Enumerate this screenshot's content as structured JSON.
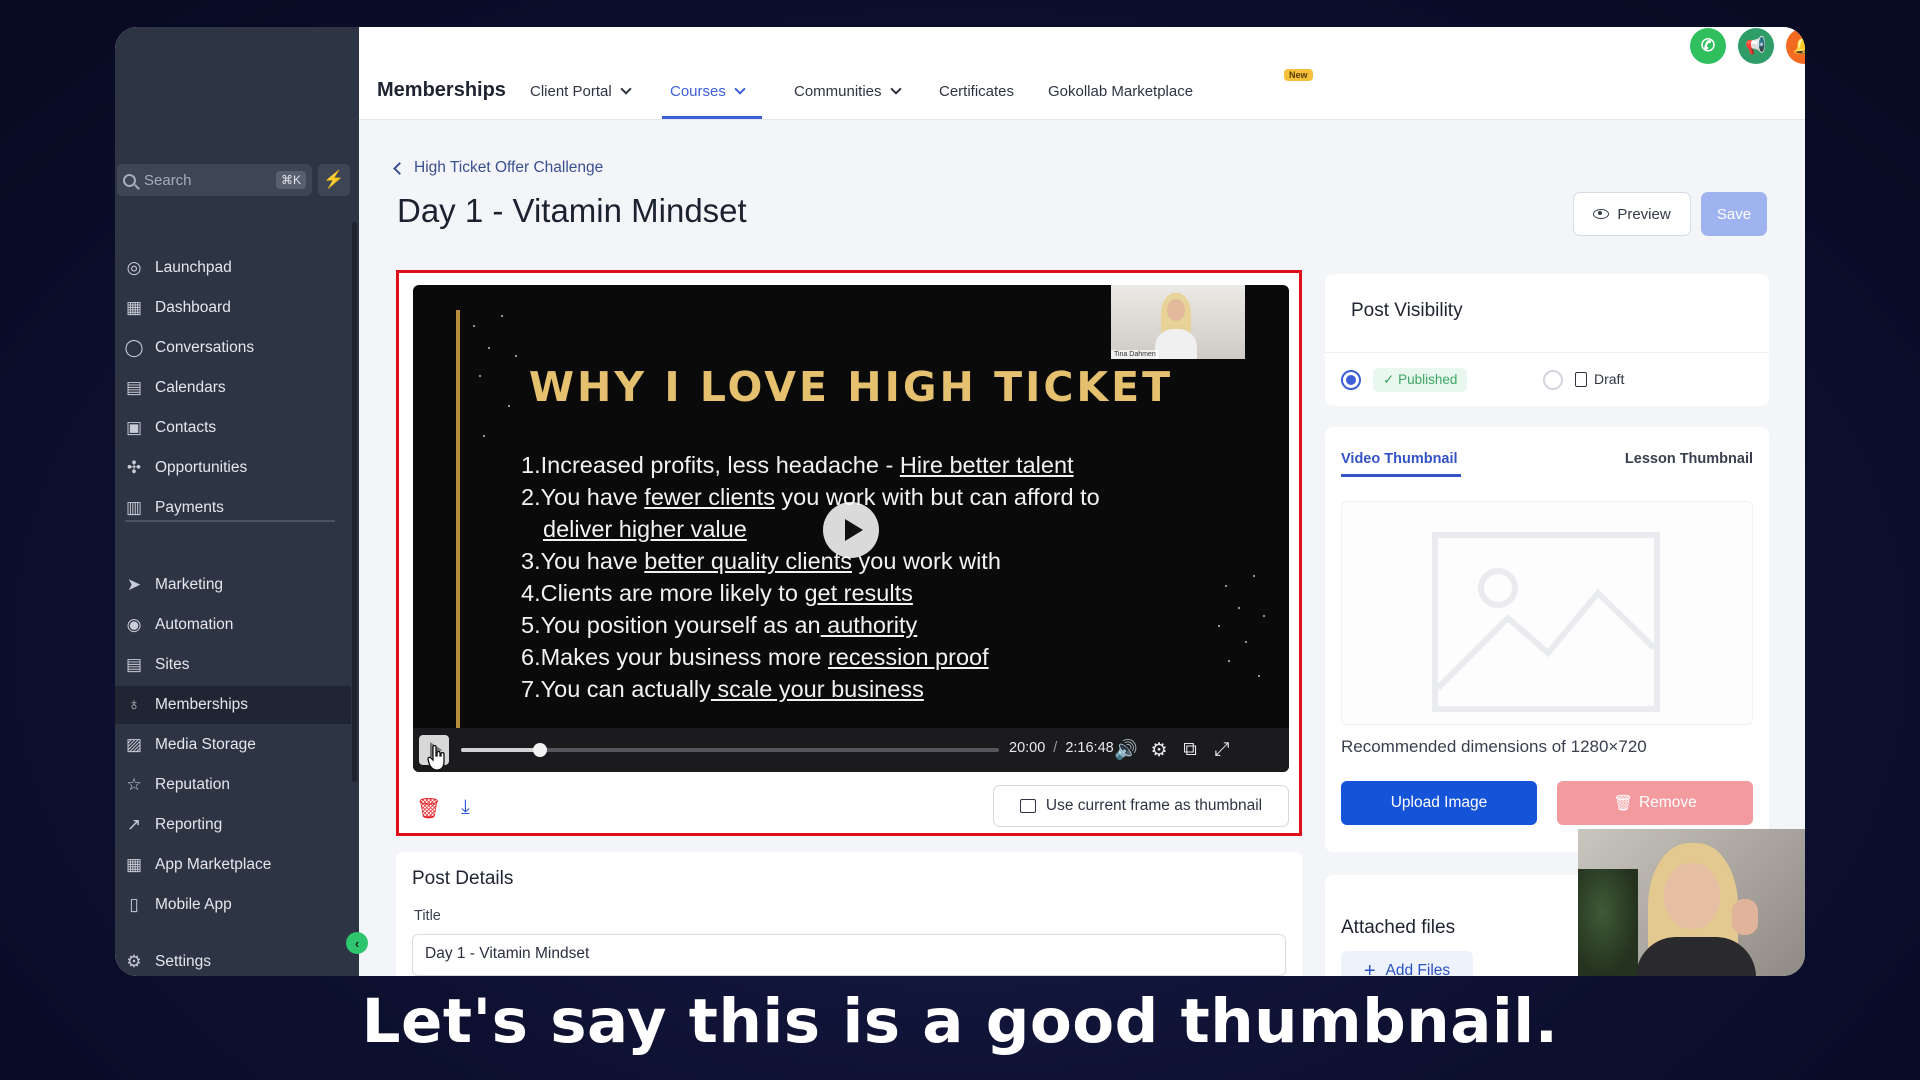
{
  "app": {
    "name": "Memberships"
  },
  "sidebar": {
    "search_placeholder": "Search",
    "search_shortcut": "⌘K",
    "items": [
      {
        "label": "Launchpad",
        "icon": "launchpad-icon"
      },
      {
        "label": "Dashboard",
        "icon": "grid-icon"
      },
      {
        "label": "Conversations",
        "icon": "chat-icon"
      },
      {
        "label": "Calendars",
        "icon": "calendar-icon"
      },
      {
        "label": "Contacts",
        "icon": "contacts-icon"
      },
      {
        "label": "Opportunities",
        "icon": "opportunities-icon"
      },
      {
        "label": "Payments",
        "icon": "payments-icon"
      },
      {
        "label": "Marketing",
        "icon": "send-icon"
      },
      {
        "label": "Automation",
        "icon": "automation-icon"
      },
      {
        "label": "Sites",
        "icon": "sites-icon"
      },
      {
        "label": "Memberships",
        "icon": "memberships-icon",
        "active": true
      },
      {
        "label": "Media Storage",
        "icon": "image-icon"
      },
      {
        "label": "Reputation",
        "icon": "star-icon"
      },
      {
        "label": "Reporting",
        "icon": "trend-icon"
      },
      {
        "label": "App Marketplace",
        "icon": "apps-icon"
      },
      {
        "label": "Mobile App",
        "icon": "phone-icon"
      }
    ],
    "settings_label": "Settings"
  },
  "topnav": {
    "title": "Memberships",
    "tabs": [
      {
        "label": "Client Portal",
        "dropdown": true
      },
      {
        "label": "Courses",
        "dropdown": true,
        "active": true
      },
      {
        "label": "Communities",
        "dropdown": true
      },
      {
        "label": "Certificates"
      },
      {
        "label": "Gokollab Marketplace",
        "badge": "New"
      }
    ],
    "icons": [
      {
        "name": "phone-call-icon",
        "color": "#2fbf5d",
        "glyph": "✆"
      },
      {
        "name": "megaphone-icon",
        "color": "#2f9d68",
        "glyph": "📢"
      },
      {
        "name": "bell-icon",
        "color": "#f26b21",
        "glyph": "🔔"
      },
      {
        "name": "help-icon",
        "color": "#2b8de8",
        "glyph": "?"
      },
      {
        "name": "user-avatar-icon",
        "color": "#c8b5a0",
        "glyph": ""
      }
    ]
  },
  "page": {
    "breadcrumb": "High Ticket Offer Challenge",
    "title": "Day 1 - Vitamin Mindset",
    "preview_label": "Preview",
    "save_label": "Save"
  },
  "video": {
    "cam_label": "Tina Dahmen",
    "slide_title": "WHY I LOVE HIGH TICKET",
    "slide_items": [
      {
        "num": "1.",
        "parts": [
          [
            "Increased profits, less headache - ",
            false
          ],
          [
            " Hire better talent",
            true
          ]
        ]
      },
      {
        "num": "2.",
        "parts": [
          [
            "You have ",
            false
          ],
          [
            "fewer clients",
            true
          ],
          [
            " you work with but can afford to",
            false
          ]
        ]
      },
      {
        "num": "",
        "parts": [
          [
            "deliver higher value",
            true
          ]
        ]
      },
      {
        "num": "3.",
        "parts": [
          [
            "You have ",
            false
          ],
          [
            "better quality clients",
            true
          ],
          [
            " you work with",
            false
          ]
        ]
      },
      {
        "num": "4.",
        "parts": [
          [
            "Clients are more likely to ",
            false
          ],
          [
            "get results",
            true
          ]
        ]
      },
      {
        "num": "5.",
        "parts": [
          [
            "You position yourself as an",
            false
          ],
          [
            " authority",
            true
          ]
        ]
      },
      {
        "num": "6.",
        "parts": [
          [
            "Makes your business more ",
            false
          ],
          [
            "recession proof",
            true
          ]
        ]
      },
      {
        "num": "7.",
        "parts": [
          [
            "You can actually",
            false
          ],
          [
            " scale your business",
            true
          ]
        ]
      }
    ],
    "current_time": "20:00",
    "duration": "2:16:48",
    "progress_fraction": 0.146,
    "use_frame_label": "Use current frame as thumbnail"
  },
  "post_details": {
    "heading": "Post Details",
    "title_label": "Title",
    "title_value": "Day 1 - Vitamin Mindset"
  },
  "visibility": {
    "heading": "Post Visibility",
    "published_label": "Published",
    "draft_label": "Draft",
    "selected": "published"
  },
  "thumbnail": {
    "tab_video": "Video Thumbnail",
    "tab_lesson": "Lesson Thumbnail",
    "recommended": "Recommended dimensions of 1280×720",
    "upload_label": "Upload Image",
    "remove_label": "Remove"
  },
  "attached": {
    "heading": "Attached files",
    "add_label": "Add Files"
  },
  "caption": "Let's say this is a good thumbnail."
}
